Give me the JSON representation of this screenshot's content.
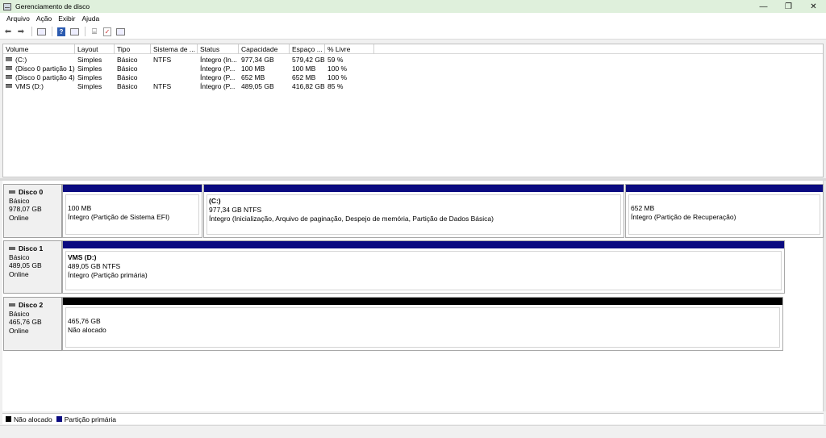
{
  "window": {
    "title": "Gerenciamento de disco",
    "minimize": "—",
    "restore": "❐",
    "close": "✕"
  },
  "menu": [
    "Arquivo",
    "Ação",
    "Exibir",
    "Ajuda"
  ],
  "toolbar": {
    "icons": [
      "back-arrow-icon",
      "forward-arrow-icon",
      "properties-icon",
      "help-icon",
      "connect-drive-icon",
      "check-icon",
      "list-view-icon"
    ]
  },
  "volume_table": {
    "headers": [
      "Volume",
      "Layout",
      "Tipo",
      "Sistema de ...",
      "Status",
      "Capacidade",
      "Espaço ...",
      "% Livre"
    ],
    "rows": [
      [
        "(C:)",
        "Simples",
        "Básico",
        "NTFS",
        "Íntegro (In...",
        "977,34 GB",
        "579,42 GB",
        "59 %"
      ],
      [
        "(Disco 0 partição 1)",
        "Simples",
        "Básico",
        "",
        "Íntegro (P...",
        "100 MB",
        "100 MB",
        "100 %"
      ],
      [
        "(Disco 0 partição 4)",
        "Simples",
        "Básico",
        "",
        "Íntegro (P...",
        "652 MB",
        "652 MB",
        "100 %"
      ],
      [
        "VMS (D:)",
        "Simples",
        "Básico",
        "NTFS",
        "Íntegro (P...",
        "489,05 GB",
        "416,82 GB",
        "85 %"
      ]
    ]
  },
  "disks": [
    {
      "name": "Disco 0",
      "type": "Básico",
      "size": "978,07 GB",
      "status": "Online",
      "partitions": [
        {
          "name": "",
          "size": "100 MB",
          "status": "Íntegro (Partição de Sistema EFI)",
          "bar": "primary"
        },
        {
          "name": "(C:)",
          "size": "977,34 GB NTFS",
          "status": "Íntegro (Inicialização, Arquivo de paginação, Despejo de memória, Partição de Dados Básica)",
          "bar": "primary"
        },
        {
          "name": "",
          "size": "652 MB",
          "status": "Íntegro (Partição de Recuperação)",
          "bar": "primary"
        }
      ]
    },
    {
      "name": "Disco 1",
      "type": "Básico",
      "size": "489,05 GB",
      "status": "Online",
      "partitions": [
        {
          "name": "VMS  (D:)",
          "size": "489,05 GB NTFS",
          "status": "Íntegro (Partição primária)",
          "bar": "primary"
        }
      ]
    },
    {
      "name": "Disco 2",
      "type": "Básico",
      "size": "465,76 GB",
      "status": "Online",
      "partitions": [
        {
          "name": "",
          "size": "465,76 GB",
          "status": "Não alocado",
          "bar": "unallocated"
        }
      ]
    }
  ],
  "legend": [
    {
      "label": "Não alocado",
      "color": "#000000"
    },
    {
      "label": "Partição primária",
      "color": "#0a0a80"
    }
  ],
  "colors": {
    "primary_partition": "#0a0a80",
    "unallocated": "#000000",
    "titlebar": "#dff0dc"
  }
}
